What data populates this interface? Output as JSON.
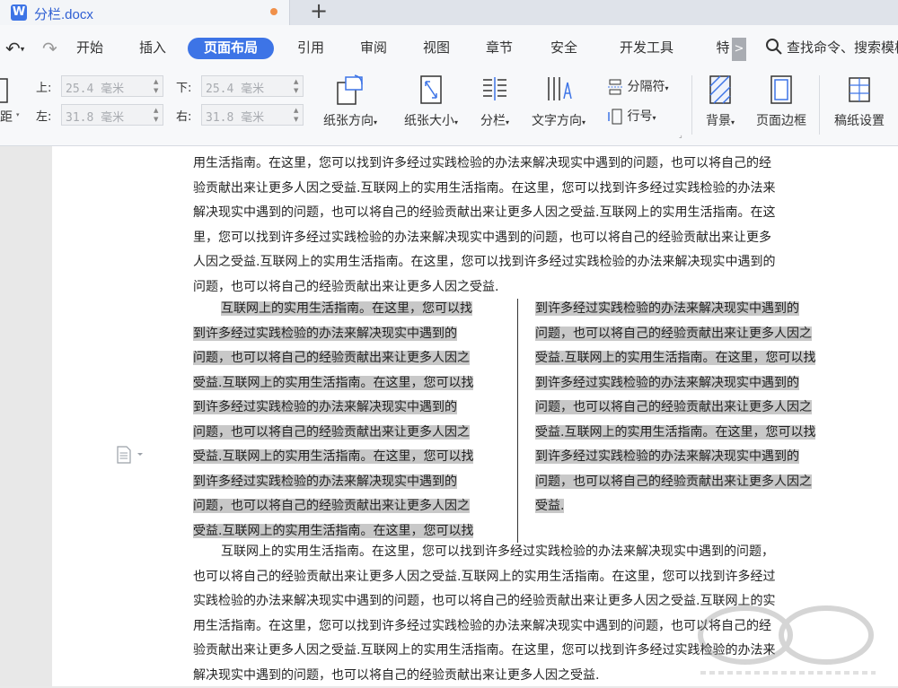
{
  "window": {
    "tab_title": "分栏.docx",
    "new_tab_symbol": "+"
  },
  "menu": {
    "items": [
      "开始",
      "插入",
      "页面布局",
      "引用",
      "审阅",
      "视图",
      "章节",
      "安全",
      "开发工具",
      "特"
    ],
    "active": "页面布局",
    "more_symbol": ">",
    "search_label": "查找命令、搜索模板"
  },
  "ribbon": {
    "margin_partial_label": "距",
    "margins": {
      "top_label": "上:",
      "top_value": "25.4 毫米",
      "bottom_label": "下:",
      "bottom_value": "25.4 毫米",
      "left_label": "左:",
      "left_value": "31.8 毫米",
      "right_label": "右:",
      "right_value": "31.8 毫米"
    },
    "buttons": {
      "orientation": "纸张方向",
      "size": "纸张大小",
      "columns": "分栏",
      "text_direction": "文字方向",
      "separator": "分隔符",
      "line_number": "行号",
      "background": "背景",
      "page_border": "页面边框",
      "manuscript": "稿纸设置"
    },
    "dropdown_symbol": "▾"
  },
  "document": {
    "top_paragraph": [
      "用生活指南。在这里，您可以找到许多经过实践检验的办法来解决现实中遇到的问题，也可以将自己的经",
      "验贡献出来让更多人因之受益.互联网上的实用生活指南。在这里，您可以找到许多经过实践检验的办法来",
      "解决现实中遇到的问题，也可以将自己的经验贡献出来让更多人因之受益.互联网上的实用生活指南。在这",
      "里，您可以找到许多经过实践检验的办法来解决现实中遇到的问题，也可以将自己的经验贡献出来让更多",
      "人因之受益.互联网上的实用生活指南。在这里，您可以找到许多经过实践检验的办法来解决现实中遇到的",
      "问题，也可以将自己的经验贡献出来让更多人因之受益."
    ],
    "left_column": [
      "互联网上的实用生活指南。在这里，您可以找",
      "到许多经过实践检验的办法来解决现实中遇到的",
      "问题，也可以将自己的经验贡献出来让更多人因之",
      "受益.互联网上的实用生活指南。在这里，您可以找",
      "到许多经过实践检验的办法来解决现实中遇到的",
      "问题，也可以将自己的经验贡献出来让更多人因之",
      "受益.互联网上的实用生活指南。在这里，您可以找",
      "到许多经过实践检验的办法来解决现实中遇到的",
      "问题，也可以将自己的经验贡献出来让更多人因之",
      "受益.互联网上的实用生活指南。在这里，您可以找"
    ],
    "right_column": [
      "到许多经过实践检验的办法来解决现实中遇到的",
      "问题，也可以将自己的经验贡献出来让更多人因之",
      "受益.互联网上的实用生活指南。在这里，您可以找",
      "到许多经过实践检验的办法来解决现实中遇到的",
      "问题，也可以将自己的经验贡献出来让更多人因之",
      "受益.互联网上的实用生活指南。在这里，您可以找",
      "到许多经过实践检验的办法来解决现实中遇到的",
      "问题，也可以将自己的经验贡献出来让更多人因之",
      "受益."
    ],
    "bottom_paragraph": [
      "互联网上的实用生活指南。在这里，您可以找到许多经过实践检验的办法来解决现实中遇到的问题，",
      "也可以将自己的经验贡献出来让更多人因之受益.互联网上的实用生活指南。在这里，您可以找到许多经过",
      "实践检验的办法来解决现实中遇到的问题，也可以将自己的经验贡献出来让更多人因之受益.互联网上的实",
      "用生活指南。在这里，您可以找到许多经过实践检验的办法来解决现实中遇到的问题，也可以将自己的经",
      "验贡献出来让更多人因之受益.互联网上的实用生活指南。在这里，您可以找到许多经过实践检验的办法来",
      "解决现实中遇到的问题，也可以将自己的经验贡献出来让更多人因之受益."
    ],
    "selection_color": "#c8c8c8"
  },
  "colors": {
    "accent": "#3d74e6",
    "tab_title": "#2f5fd3",
    "modified_dot": "#f0904a"
  }
}
